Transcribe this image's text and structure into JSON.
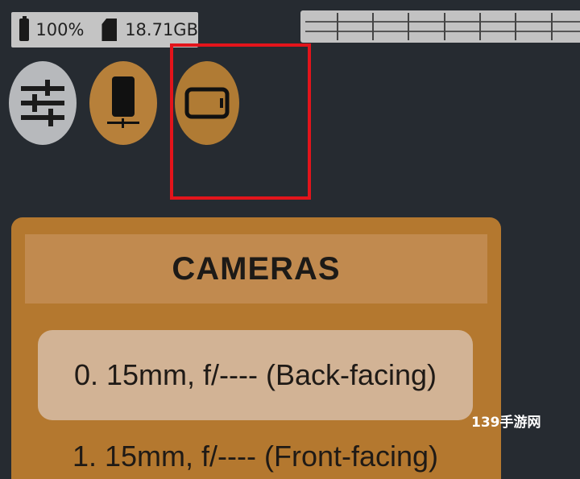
{
  "status": {
    "battery": "100%",
    "storage": "18.71GB"
  },
  "icons": {
    "settings": "sliders-icon",
    "portrait": "phone-portrait-icon",
    "landscape": "phone-landscape-icon"
  },
  "cameras": {
    "header": "CAMERAS",
    "items": [
      {
        "label": "0. 15mm, f/---- (Back-facing)",
        "selected": true
      },
      {
        "label": "1. 15mm, f/---- (Front-facing)",
        "selected": false
      }
    ]
  },
  "watermark": "139手游网",
  "colors": {
    "accent": "#b4782f",
    "highlight": "#e3141b",
    "background": "#262b31"
  }
}
